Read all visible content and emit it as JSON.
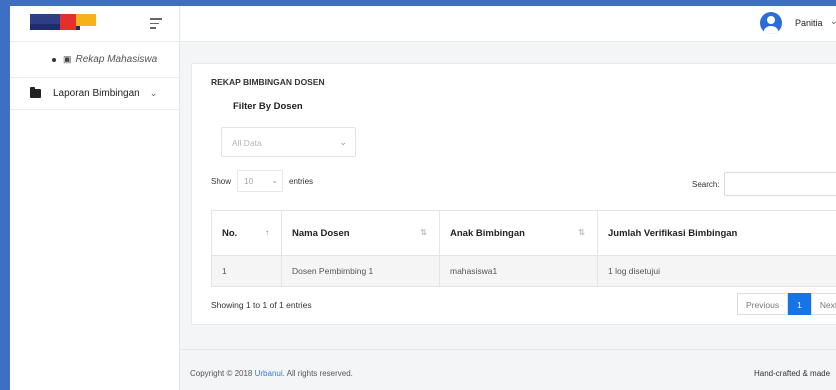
{
  "sidebar": {
    "sub_item_label": "Rekap Mahasiswa",
    "menu_item_label": "Laporan Bimbingan"
  },
  "topbar": {
    "user_name": "Panitia"
  },
  "card": {
    "title": "REKAP BIMBINGAN DOSEN",
    "filter_label": "Filter By Dosen",
    "filter_value": "All Data",
    "show_label": "Show",
    "entries_value": "10",
    "entries_label": "entries",
    "search_label": "Search:"
  },
  "table": {
    "headers": [
      "No.",
      "Nama Dosen",
      "Anak Bimbingan",
      "Jumlah Verifikasi Bimbingan"
    ],
    "rows": [
      [
        "1",
        "Dosen Pembimbing 1",
        "mahasiswa1",
        "1 log disetujui"
      ]
    ]
  },
  "pagination": {
    "info": "Showing 1 to 1 of 1 entries",
    "previous": "Previous",
    "current": "1",
    "next": "Next"
  },
  "footer": {
    "copyright_prefix": "Copyright © 2018 ",
    "brand_link": "Urbanui",
    "copyright_suffix": ". All rights reserved.",
    "handcrafted": "Hand-crafted & made"
  },
  "colors": {
    "accent": "#1574e6",
    "frame": "#3f6fc2",
    "avatar": "#2b6cd8"
  }
}
